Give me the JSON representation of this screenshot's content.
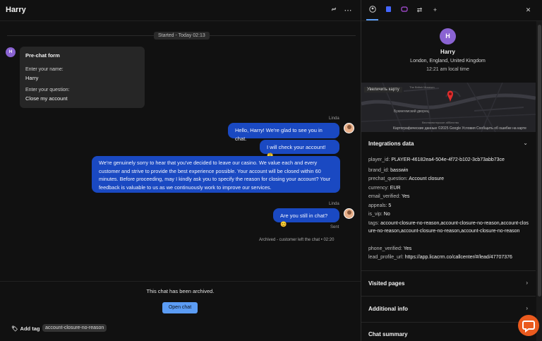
{
  "chat": {
    "title": "Harry",
    "started": "Started - Today 02:13",
    "visitor_initial": "H",
    "prechat": {
      "title": "Pre-chat form",
      "q1_label": "Enter your name:",
      "q1_value": "Harry",
      "q2_label": "Enter your question:",
      "q2_value": "Close my account"
    },
    "agent_name": "Linda",
    "messages": [
      "Hello, Harry! We're glad to see you in chat.",
      "I will check your account! 🤔",
      "We're genuinely sorry to hear that you've decided to leave our casino. We value each and every customer and strive to provide the best experience possible. Your account will be closed within 60 minutes. Before proceeding, may I kindly ask you to specify the reason for closing your account? Your feedback is valuable to us as we continuously work to improve our services.",
      "Are you still in chat? 😊"
    ],
    "agent_name_2": "Linda",
    "sent_label": "Sent",
    "archived_event": "Archived - customer left the chat • 02:20",
    "archived_notice": "This chat has been archived.",
    "open_chat_label": "Open chat",
    "add_tag_label": "Add tag",
    "tag": "account-closure-no-reason"
  },
  "details": {
    "profile": {
      "initial": "H",
      "name": "Harry",
      "location": "London, England, United Kingdom",
      "local_time": "12:21 am local time"
    },
    "map": {
      "zoom_label": "Увеличить карту",
      "credits": "Картографические данные ©2025 Google   Условия   Сообщить об ошибке на карте",
      "places": [
        "Букингемский дворец",
        "The British Museum",
        "Вестминстерское аббатство"
      ]
    },
    "integrations": {
      "title": "Integrations data",
      "rows": [
        {
          "k": "player_id:",
          "v": "PLAYER-46182ea4-504e-4f72-b102-3cb73abb73ce"
        },
        {
          "k": "brand_id:",
          "v": "basswin"
        },
        {
          "k": "prechat_question:",
          "v": "Account closure"
        },
        {
          "k": "currency:",
          "v": "EUR"
        },
        {
          "k": "email_verified:",
          "v": "Yes"
        },
        {
          "k": "appeals:",
          "v": "5"
        },
        {
          "k": "is_vip:",
          "v": "No"
        },
        {
          "k": "tags:",
          "v": "account-closure-no-reason,account-closure-no-reason,account-closure-no-reason,account-closure-no-reason,account-closure-no-reason"
        },
        {
          "k": "phone_verified:",
          "v": "Yes"
        },
        {
          "k": "lead_profile_url:",
          "v": "https://app.licacrm.co/callcenter/#/lead/47707376"
        }
      ]
    },
    "sections": {
      "visited_pages": "Visited pages",
      "additional_info": "Additional info",
      "chat_summary": "Chat summary"
    }
  },
  "colors": {
    "bubble": "#1a49c2",
    "accent": "#5b9cf4",
    "avatar": "#8a63d2",
    "fab": "#ea5a1e"
  }
}
